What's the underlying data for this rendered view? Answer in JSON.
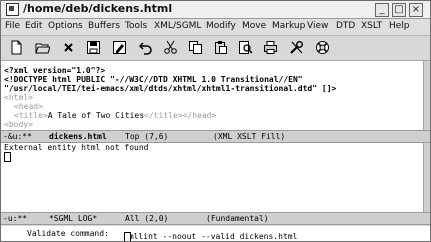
{
  "window": {
    "title": "/home/deb/dickens.html"
  },
  "titlebar_buttons": [
    "_",
    "□",
    "×"
  ],
  "menu": [
    "File",
    "Edit",
    "Options",
    "Buffers",
    "Tools",
    "XML/SGML",
    "Modify",
    "Move",
    "Markup",
    "View",
    "DTD",
    "XSLT",
    "Help"
  ],
  "toolbar": {
    "icons": [
      "new-file-icon",
      "open-folder-icon",
      "close-x-icon",
      "save-disk-icon",
      "save-as-icon",
      "undo-icon",
      "cut-scissors-icon",
      "copy-icon",
      "paste-icon",
      "search-icon",
      "print-icon",
      "tools-icon",
      "help-lifesaver-icon"
    ]
  },
  "editor": {
    "lines": {
      "l1": "<?xml version=\"1.0\"?>",
      "l2": "<!DOCTYPE html PUBLIC \"-//W3C//DTD XHTML 1.0 Transitional//EN\"",
      "l3": "\"/usr/local/TEI/tei-emacs/xml/dtds/xhtml/xhtml1-transitional.dtd\" []>",
      "l4": "<html>",
      "l5": "<head>",
      "l6_open": "<title>",
      "l6_text": "A Tale of Two Cities",
      "l6_close": "</title></head>",
      "l7": "<body>"
    }
  },
  "modeline_top": {
    "flag": "-&u:**",
    "buffer": "dickens.html",
    "position": "Top (7,6)",
    "modes": "(XML XSLT Fill)"
  },
  "output": {
    "message": "External entity html not found"
  },
  "modeline_bottom": {
    "flag": "-u:**",
    "buffer": "*SGML LOG*",
    "position": "All (2,0)",
    "modes": "(Fundamental)"
  },
  "minibuffer": {
    "prompt": "Validate command:",
    "value": "xmllint --noout --valid dickens.html"
  },
  "colors": {
    "window_bg": "#d6d6d6",
    "pane_bg": "#ffffff",
    "modeline_bg": "#cfcfcf"
  }
}
